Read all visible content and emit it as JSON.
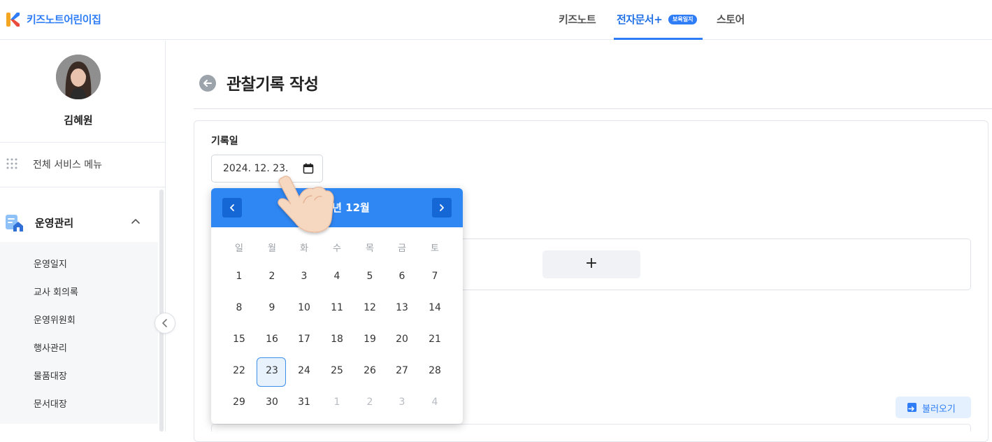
{
  "topbar": {
    "brand": "키즈노트어린이집",
    "nav": [
      {
        "label": "키즈노트"
      },
      {
        "label": "전자문서+"
      },
      {
        "label": "스토어"
      }
    ],
    "nav_badge": "보육일지",
    "active_nav": "전자문서+",
    "accent_color": "#2f7df6"
  },
  "sidebar": {
    "user_name": "김혜원",
    "all_menu_label": "전체 서비스 메뉴",
    "section_label": "운영관리",
    "items": [
      {
        "label": "운영일지"
      },
      {
        "label": "교사 회의록"
      },
      {
        "label": "운영위원회"
      },
      {
        "label": "행사관리"
      },
      {
        "label": "물품대장"
      },
      {
        "label": "문서대장"
      }
    ]
  },
  "main": {
    "title": "관찰기록 작성",
    "date_label": "기록일",
    "date_value": "2024. 12. 23.",
    "add_symbol": "+",
    "load_button_label": "불러오기"
  },
  "calendar": {
    "title": "년 12월",
    "weekdays": [
      "일",
      "월",
      "화",
      "수",
      "목",
      "금",
      "토"
    ],
    "weeks": [
      [
        "1",
        "2",
        "3",
        "4",
        "5",
        "6",
        "7"
      ],
      [
        "8",
        "9",
        "10",
        "11",
        "12",
        "13",
        "14"
      ],
      [
        "15",
        "16",
        "17",
        "18",
        "19",
        "20",
        "21"
      ],
      [
        "22",
        "23",
        "24",
        "25",
        "26",
        "27",
        "28"
      ],
      [
        "29",
        "30",
        "31",
        "1",
        "2",
        "3",
        "4"
      ]
    ],
    "selected_day": "23",
    "header_color": "#2f87f3"
  }
}
